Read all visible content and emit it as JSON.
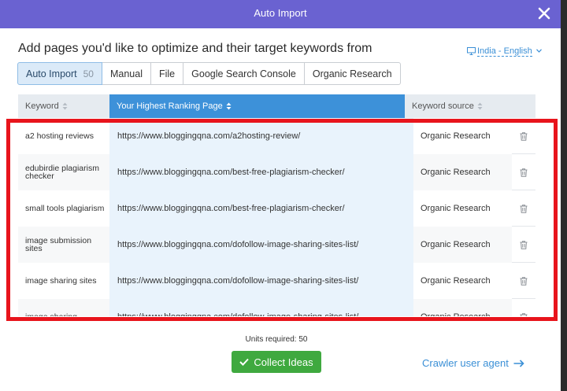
{
  "modal": {
    "title": "Auto Import"
  },
  "headline": "Add pages you'd like to optimize and their target keywords from",
  "locale": "India - English",
  "tabs": [
    {
      "label": "Auto Import",
      "count": "50",
      "active": true
    },
    {
      "label": "Manual"
    },
    {
      "label": "File"
    },
    {
      "label": "Google Search Console"
    },
    {
      "label": "Organic Research"
    }
  ],
  "table": {
    "columns": [
      "Keyword",
      "Your Highest Ranking Page",
      "Keyword source"
    ],
    "rows": [
      {
        "keyword": "a2 hosting reviews",
        "page": "https://www.bloggingqna.com/a2hosting-review/",
        "source": "Organic Research"
      },
      {
        "keyword": "edubirdie plagiarism checker",
        "page": "https://www.bloggingqna.com/best-free-plagiarism-checker/",
        "source": "Organic Research"
      },
      {
        "keyword": "small tools plagiarism",
        "page": "https://www.bloggingqna.com/best-free-plagiarism-checker/",
        "source": "Organic Research"
      },
      {
        "keyword": "image submission sites",
        "page": "https://www.bloggingqna.com/dofollow-image-sharing-sites-list/",
        "source": "Organic Research"
      },
      {
        "keyword": "image sharing sites",
        "page": "https://www.bloggingqna.com/dofollow-image-sharing-sites-list/",
        "source": "Organic Research"
      },
      {
        "keyword": "image sharing",
        "page": "https://www.bloggingqna.com/dofollow-image-sharing-sites-list/",
        "source": "Organic Research"
      }
    ]
  },
  "footer": {
    "units_required": "Units required: 50",
    "collect_label": "Collect Ideas",
    "crawler_label": "Crawler user agent"
  },
  "colors": {
    "header": "#6a62d1",
    "accent_blue": "#3d91d9",
    "button_green": "#3fa93f",
    "highlight_red": "#e8141c"
  }
}
